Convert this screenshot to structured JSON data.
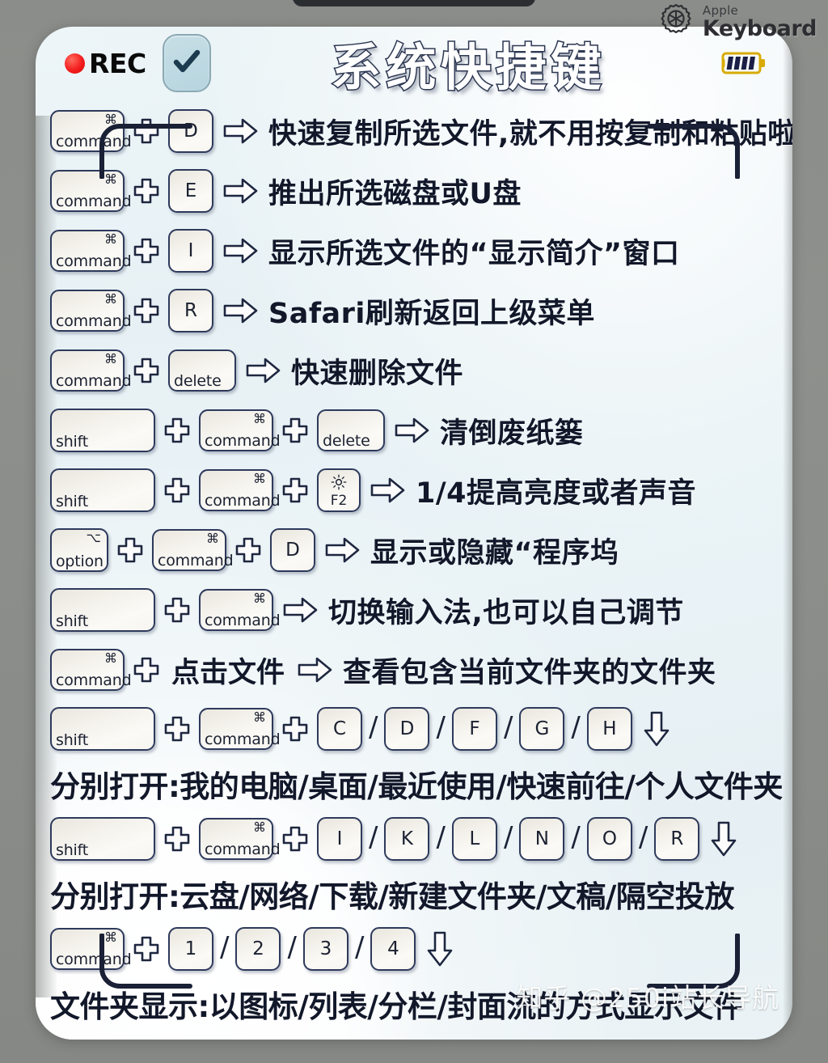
{
  "brand": {
    "line1": "Apple",
    "line2": "Keyboard",
    "gear_icon": "gear-icon"
  },
  "header": {
    "rec_label": "REC",
    "rec_dot_color": "#f31d1d",
    "checkbox_icon": "check-icon",
    "checkbox_checked": true,
    "title": "系统快捷键",
    "title_color": "#ffffff",
    "title_outline_color": "#2a3550",
    "battery_icon": "battery-icon",
    "battery_bars": 4,
    "battery_color": "#e0b400"
  },
  "keys": {
    "command_label": "command",
    "command_symbol": "⌘",
    "shift_label": "shift",
    "option_label": "option",
    "option_symbol": "⌥",
    "delete_label": "delete",
    "f2_label": "F2"
  },
  "rows": [
    {
      "id": "cmd-d",
      "keys": [
        {
          "type": "command",
          "label": "command",
          "symbol": "⌘"
        },
        {
          "type": "plus"
        },
        {
          "type": "letter",
          "label": "D"
        }
      ],
      "arrow": "arrow-right",
      "desc": "快速复制所选文件,就不用按复制和粘贴啦"
    },
    {
      "id": "cmd-e",
      "keys": [
        {
          "type": "command",
          "label": "command",
          "symbol": "⌘"
        },
        {
          "type": "plus"
        },
        {
          "type": "letter",
          "label": "E"
        }
      ],
      "arrow": "arrow-right",
      "desc": "推出所选磁盘或U盘"
    },
    {
      "id": "cmd-i",
      "keys": [
        {
          "type": "command",
          "label": "command",
          "symbol": "⌘"
        },
        {
          "type": "plus"
        },
        {
          "type": "letter",
          "label": "I"
        }
      ],
      "arrow": "arrow-right",
      "desc": "显示所选文件的“显示简介”窗口"
    },
    {
      "id": "cmd-r",
      "keys": [
        {
          "type": "command",
          "label": "command",
          "symbol": "⌘"
        },
        {
          "type": "plus"
        },
        {
          "type": "letter",
          "label": "R"
        }
      ],
      "arrow": "arrow-right",
      "desc": "Safari刷新返回上级菜单"
    },
    {
      "id": "cmd-delete",
      "keys": [
        {
          "type": "command",
          "label": "command",
          "symbol": "⌘"
        },
        {
          "type": "plus"
        },
        {
          "type": "delete",
          "label": "delete"
        }
      ],
      "arrow": "arrow-right",
      "desc": "快速删除文件"
    },
    {
      "id": "shift-cmd-delete",
      "keys": [
        {
          "type": "shift",
          "label": "shift"
        },
        {
          "type": "plus"
        },
        {
          "type": "command",
          "label": "command",
          "symbol": "⌘"
        },
        {
          "type": "plus"
        },
        {
          "type": "delete",
          "label": "delete"
        }
      ],
      "arrow": "arrow-right",
      "desc": "清倒废纸篓"
    },
    {
      "id": "shift-cmd-f2",
      "keys": [
        {
          "type": "shift",
          "label": "shift"
        },
        {
          "type": "plus"
        },
        {
          "type": "command",
          "label": "command",
          "symbol": "⌘"
        },
        {
          "type": "plus"
        },
        {
          "type": "f2",
          "label": "F2"
        }
      ],
      "arrow": "arrow-right",
      "desc": "1/4提高亮度或者声音"
    },
    {
      "id": "option-cmd-d",
      "keys": [
        {
          "type": "option",
          "label": "option",
          "symbol": "⌥"
        },
        {
          "type": "plus"
        },
        {
          "type": "command",
          "label": "command",
          "symbol": "⌘"
        },
        {
          "type": "plus"
        },
        {
          "type": "letter",
          "label": "D"
        }
      ],
      "arrow": "arrow-right",
      "desc": "显示或隐藏“程序坞"
    },
    {
      "id": "shift-cmd",
      "keys": [
        {
          "type": "shift",
          "label": "shift"
        },
        {
          "type": "plus"
        },
        {
          "type": "command",
          "label": "command",
          "symbol": "⌘"
        }
      ],
      "arrow": "arrow-right",
      "desc": "切换输入法,也可以自己调节"
    },
    {
      "id": "cmd-click",
      "keys": [
        {
          "type": "command",
          "label": "command",
          "symbol": "⌘"
        },
        {
          "type": "plus"
        }
      ],
      "mid_label": "点击文件",
      "arrow": "arrow-right",
      "desc": "查看包含当前文件夹的文件夹"
    }
  ],
  "multi_rows": [
    {
      "id": "shift-cmd-cdfgh",
      "prefix": [
        {
          "type": "shift",
          "label": "shift"
        },
        {
          "type": "plus"
        },
        {
          "type": "command",
          "label": "command",
          "symbol": "⌘"
        },
        {
          "type": "plus"
        }
      ],
      "letters": [
        "C",
        "D",
        "F",
        "G",
        "H"
      ],
      "separator": "/",
      "arrow": "arrow-down",
      "caption": "分别打开:我的电脑/桌面/最近使用/快速前往/个人文件夹"
    },
    {
      "id": "shift-cmd-iklnor",
      "prefix": [
        {
          "type": "shift",
          "label": "shift"
        },
        {
          "type": "plus"
        },
        {
          "type": "command",
          "label": "command",
          "symbol": "⌘"
        },
        {
          "type": "plus"
        }
      ],
      "letters": [
        "I",
        "K",
        "L",
        "N",
        "O",
        "R"
      ],
      "separator": "/",
      "arrow": "arrow-down",
      "caption": "分别打开:云盘/网络/下载/新建文件夹/文稿/隔空投放"
    },
    {
      "id": "cmd-1234",
      "prefix": [
        {
          "type": "command",
          "label": "command",
          "symbol": "⌘"
        },
        {
          "type": "plus"
        }
      ],
      "letters": [
        "1",
        "2",
        "3",
        "4"
      ],
      "separator": "/",
      "arrow": "arrow-down",
      "caption": "文件夹显示:以图标/列表/分栏/封面流的方式显示文件"
    }
  ],
  "watermark": "知乎 @250i站长导航",
  "colors": {
    "card_bg": "#e8f1f5",
    "page_bg": "#8b8d8a",
    "key_border": "#2e3a5c",
    "text": "#12182a",
    "accent_blue": "#b7d5df"
  }
}
